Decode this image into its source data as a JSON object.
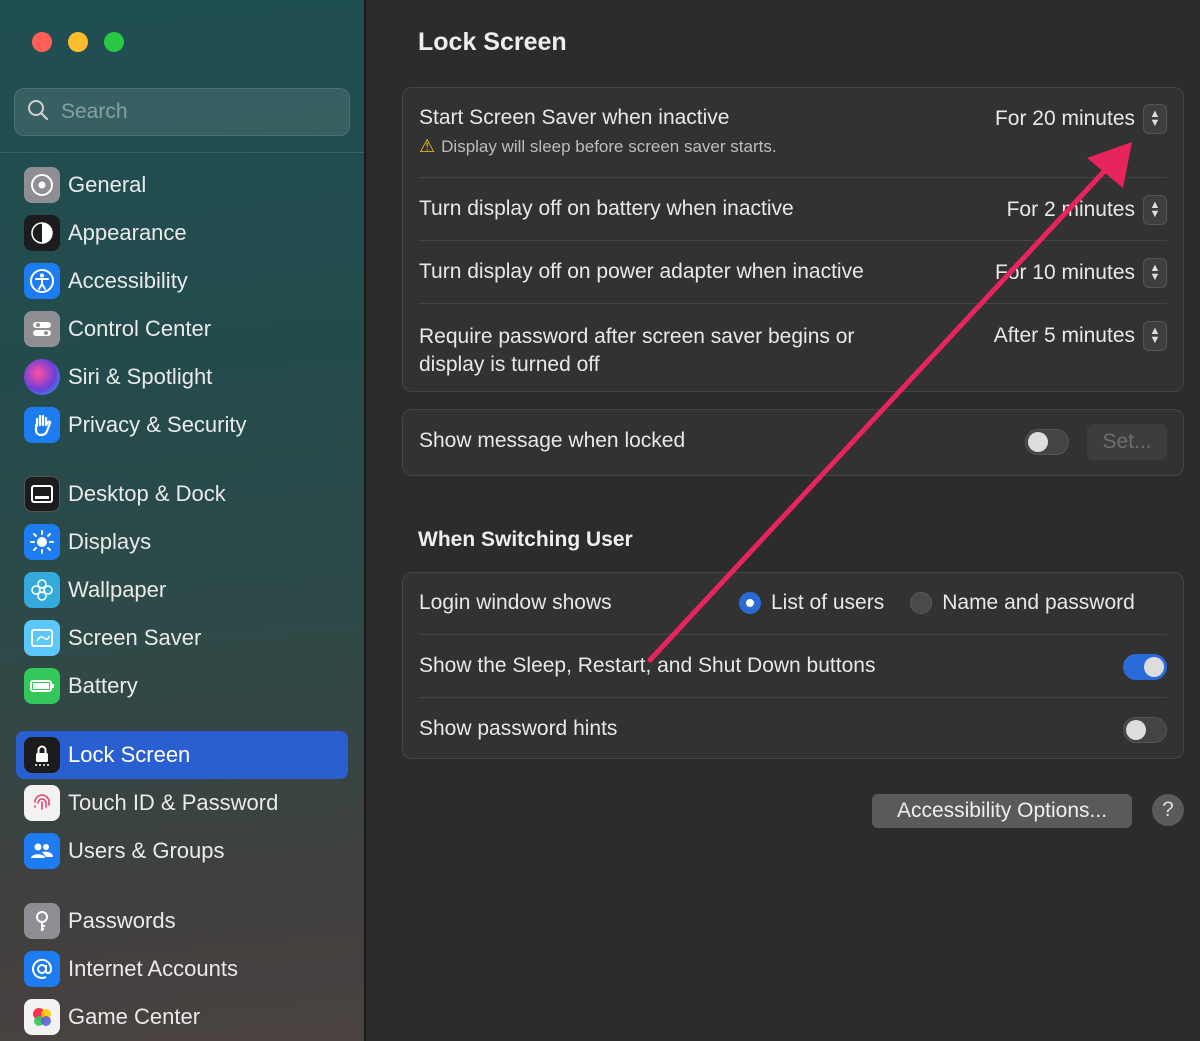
{
  "sidebar": {
    "search_placeholder": "Search",
    "items": [
      {
        "label": "General",
        "icon": "gear-icon",
        "color": "#8e8e93"
      },
      {
        "label": "Appearance",
        "icon": "appearance-icon",
        "color": "#1c1c1e"
      },
      {
        "label": "Accessibility",
        "icon": "accessibility-icon",
        "color": "#1e7cf2"
      },
      {
        "label": "Control Center",
        "icon": "control-center-icon",
        "color": "#8e8e93"
      },
      {
        "label": "Siri & Spotlight",
        "icon": "siri-icon",
        "color": "#6a3fd6"
      },
      {
        "label": "Privacy & Security",
        "icon": "hand-icon",
        "color": "#1e7cf2"
      },
      {
        "label": "Desktop & Dock",
        "icon": "dock-icon",
        "color": "#1c1c1e"
      },
      {
        "label": "Displays",
        "icon": "sun-icon",
        "color": "#1e7cf2"
      },
      {
        "label": "Wallpaper",
        "icon": "flower-icon",
        "color": "#34aadc"
      },
      {
        "label": "Screen Saver",
        "icon": "screen-saver-icon",
        "color": "#5ac8fa"
      },
      {
        "label": "Battery",
        "icon": "battery-icon",
        "color": "#34c759"
      },
      {
        "label": "Lock Screen",
        "icon": "lock-icon",
        "color": "#1c1c1e",
        "active": true
      },
      {
        "label": "Touch ID & Password",
        "icon": "fingerprint-icon",
        "color": "#f2f2f2"
      },
      {
        "label": "Users & Groups",
        "icon": "users-icon",
        "color": "#1e7cf2"
      },
      {
        "label": "Passwords",
        "icon": "key-icon",
        "color": "#8e8e93"
      },
      {
        "label": "Internet Accounts",
        "icon": "at-icon",
        "color": "#1e7cf2"
      },
      {
        "label": "Game Center",
        "icon": "game-center-icon",
        "color": "#f2f2f2"
      }
    ]
  },
  "main": {
    "title": "Lock Screen",
    "screen_saver": {
      "label": "Start Screen Saver when inactive",
      "value": "For 20 minutes",
      "warning": "Display will sleep before screen saver starts."
    },
    "display_battery": {
      "label": "Turn display off on battery when inactive",
      "value": "For 2 minutes"
    },
    "display_power": {
      "label": "Turn display off on power adapter when inactive",
      "value": "For 10 minutes"
    },
    "require_password": {
      "label_line1": "Require password after screen saver begins or",
      "label_line2": "display is turned off",
      "value": "After 5 minutes"
    },
    "show_message": {
      "label": "Show message when locked",
      "toggle": false,
      "button": "Set..."
    },
    "switching_title": "When Switching User",
    "login_window": {
      "label": "Login window shows",
      "option1": "List of users",
      "option2": "Name and password",
      "selected": "List of users"
    },
    "sleep_buttons": {
      "label": "Show the Sleep, Restart, and Shut Down buttons",
      "toggle": true
    },
    "password_hints": {
      "label": "Show password hints",
      "toggle": false
    },
    "accessibility_button": "Accessibility Options...",
    "help": "?"
  },
  "annotation_color": "#e8245c"
}
